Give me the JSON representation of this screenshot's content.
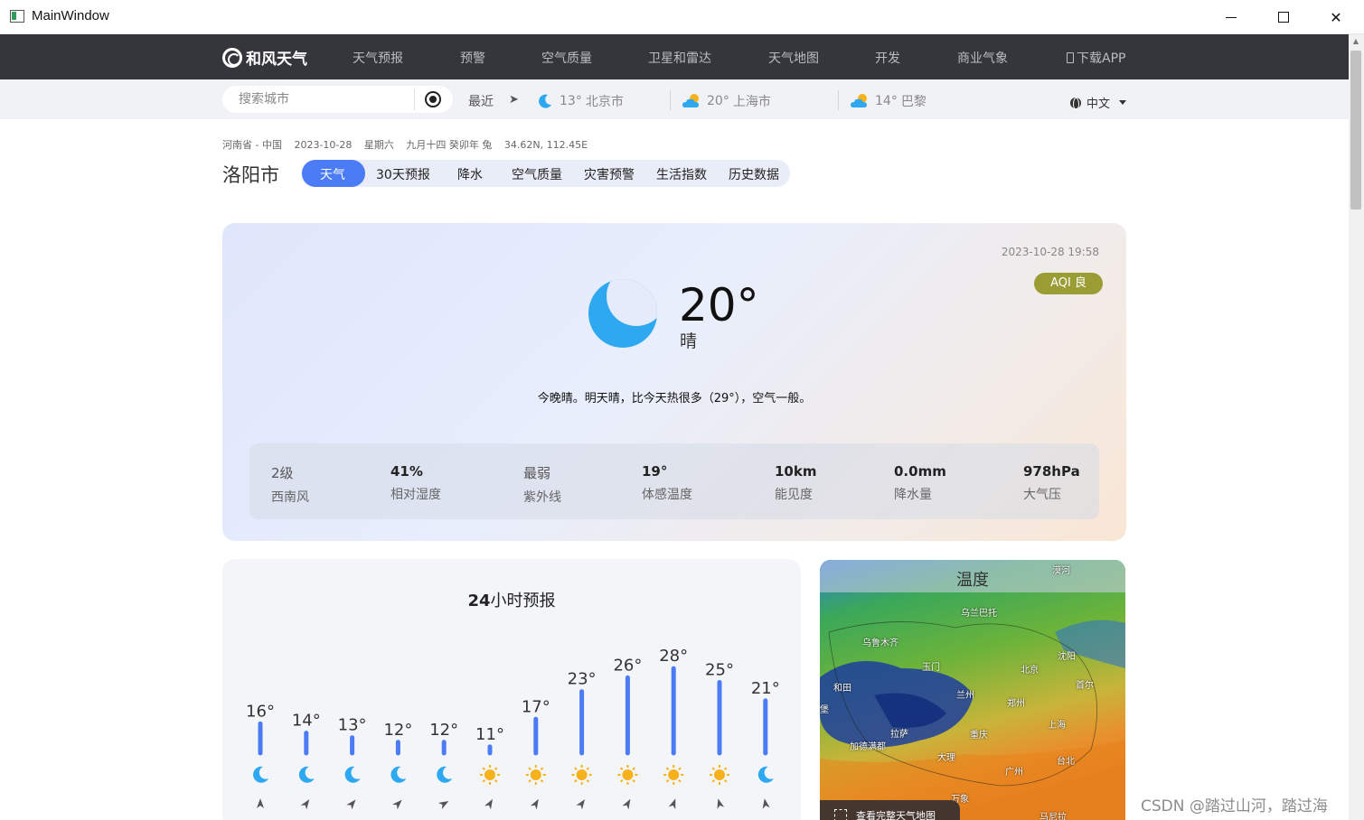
{
  "window": {
    "title": "MainWindow"
  },
  "nav": {
    "logo": "和风天气",
    "items": [
      "天气预报",
      "预警",
      "空气质量",
      "卫星和雷达",
      "天气地图",
      "开发",
      "商业气象"
    ],
    "download": "下载APP"
  },
  "search": {
    "placeholder": "搜索城市",
    "value": ""
  },
  "recent": {
    "label": "最近",
    "cities": [
      {
        "temp": "13°",
        "name": "北京市",
        "icon": "moon-icon"
      },
      {
        "temp": "20°",
        "name": "上海市",
        "icon": "partly-cloudy-icon"
      },
      {
        "temp": "14°",
        "name": "巴黎",
        "icon": "partly-cloudy-icon"
      }
    ]
  },
  "language": "中文",
  "location": {
    "region": "河南省 - 中国",
    "date": "2023-10-28",
    "weekday": "星期六",
    "lunar": "九月十四 癸卯年 兔",
    "coords": "34.62N, 112.45E",
    "city": "洛阳市"
  },
  "tabs": [
    "天气",
    "30天预报",
    "降水",
    "空气质量",
    "灾害预警",
    "生活指数",
    "历史数据"
  ],
  "now": {
    "time": "2023-10-28 19:58",
    "aqi": "AQI 良",
    "temp": "20°",
    "condition": "晴",
    "summary": "今晚晴。明天晴，比今天热很多（29°），空气一般。",
    "stats": [
      {
        "value": "2级",
        "label": "西南风"
      },
      {
        "value": "41%",
        "label": "相对湿度"
      },
      {
        "value": "最弱",
        "label": "紫外线"
      },
      {
        "value": "19°",
        "label": "体感温度"
      },
      {
        "value": "10km",
        "label": "能见度"
      },
      {
        "value": "0.0mm",
        "label": "降水量"
      },
      {
        "value": "978hPa",
        "label": "大气压"
      }
    ]
  },
  "hourly": {
    "title_bold": "24",
    "title_rest": "小时预报",
    "temps": [
      16,
      14,
      13,
      12,
      12,
      11,
      17,
      23,
      26,
      28,
      25,
      21
    ],
    "temp_labels": [
      "16°",
      "14°",
      "13°",
      "12°",
      "12°",
      "11°",
      "17°",
      "23°",
      "26°",
      "28°",
      "25°",
      "21°"
    ],
    "icons": [
      "moon",
      "moon",
      "moon",
      "moon",
      "moon",
      "sun",
      "sun",
      "sun",
      "sun",
      "sun",
      "sun",
      "moon"
    ],
    "accent": "#4b7cf5",
    "sun_color": "#f7b21b",
    "moon_color": "#2ea8f0"
  },
  "map": {
    "title": "温度",
    "labels": [
      "漠河",
      "乌兰巴托",
      "乌鲁木齐",
      "沈阳",
      "玉门",
      "北京",
      "首尔",
      "和田",
      "兰州",
      "郑州",
      "拉萨",
      "重庆",
      "上海",
      "加德满都",
      "大理",
      "台北",
      "广州",
      "万象",
      "马尼拉",
      "堡"
    ],
    "full_map_button": "查看完整天气地图"
  },
  "watermark": "CSDN @踏过山河，踏过海"
}
